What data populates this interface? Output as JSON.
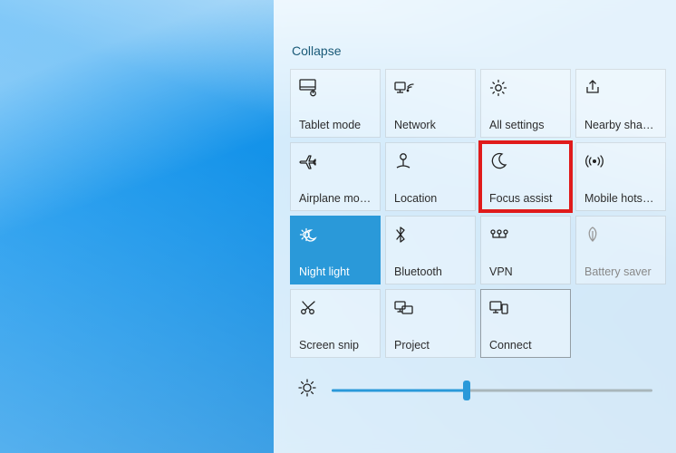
{
  "collapse_label": "Collapse",
  "tiles": [
    {
      "label": "Tablet mode"
    },
    {
      "label": "Network"
    },
    {
      "label": "All settings"
    },
    {
      "label": "Nearby sharing"
    },
    {
      "label": "Airplane mode"
    },
    {
      "label": "Location"
    },
    {
      "label": "Focus assist"
    },
    {
      "label": "Mobile hotspot"
    },
    {
      "label": "Night light"
    },
    {
      "label": "Bluetooth"
    },
    {
      "label": "VPN"
    },
    {
      "label": "Battery saver"
    },
    {
      "label": "Screen snip"
    },
    {
      "label": "Project"
    },
    {
      "label": "Connect"
    }
  ],
  "brightness": {
    "value": 42,
    "min": 0,
    "max": 100
  },
  "colors": {
    "accent": "#2a99d9",
    "highlight": "#e01b1b"
  }
}
